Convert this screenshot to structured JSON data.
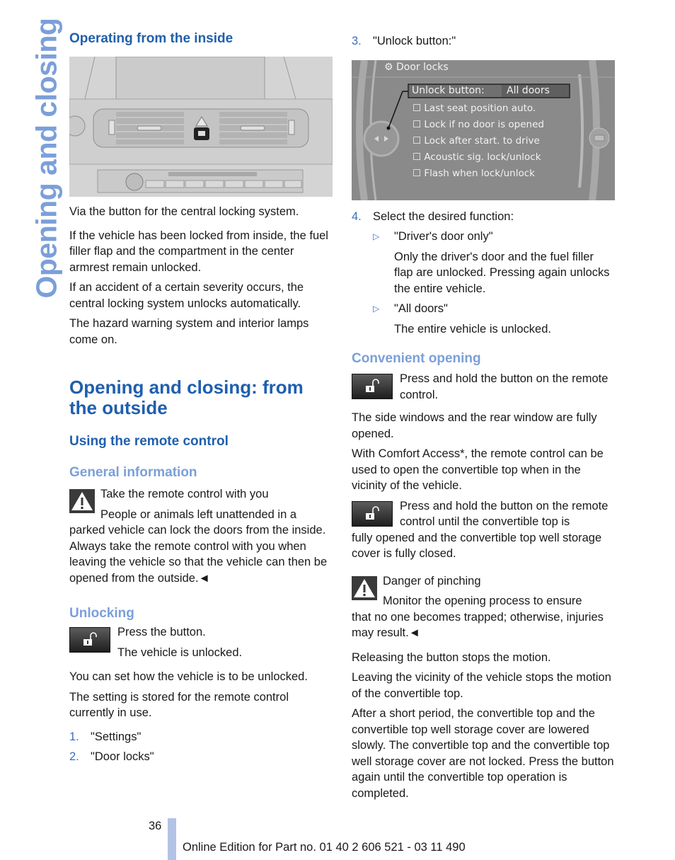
{
  "side_title": "Opening and closing",
  "left": {
    "heading_inside": "Operating from the inside",
    "p_via": "Via the button for the central locking system.",
    "p_locked_inside": "If the vehicle has been locked from inside, the fuel filler flap and the compartment in the center armrest remain unlocked.",
    "p_accident": "If an accident of a certain severity occurs, the central locking system unlocks automatically.",
    "p_hazard": "The hazard warning system and interior lamps come on.",
    "section_title": "Opening and closing: from the outside",
    "heading_remote": "Using the remote control",
    "heading_general": "General information",
    "warning_title": "Take the remote control with you",
    "warning_text_first": "People or animals left unattended in a",
    "warning_text_rest": "parked vehicle can lock the doors from the inside. Always take the remote control with you when leaving the vehicle so that the vehicle can then be opened from the outside.◄",
    "heading_unlocking": "Unlocking",
    "press_button": "Press the button.",
    "vehicle_unlocked": "The vehicle is unlocked.",
    "p_set_unlock": "You can set how the vehicle is to be unlocked.",
    "p_setting_stored": "The setting is stored for the remote control currently in use.",
    "steps": [
      {
        "num": "1.",
        "text": "\"Settings\""
      },
      {
        "num": "2.",
        "text": "\"Door locks\""
      }
    ]
  },
  "right": {
    "step3": {
      "num": "3.",
      "text": "\"Unlock button:\""
    },
    "screen": {
      "title": "Door locks",
      "unlock_label": "Unlock button:",
      "unlock_value": "All doors",
      "options": [
        "Last seat position auto.",
        "Lock if no door is opened",
        "Lock after start. to drive",
        "Acoustic sig. lock/unlock",
        "Flash when lock/unlock"
      ]
    },
    "step4": {
      "num": "4.",
      "text": "Select the desired function:"
    },
    "opt_driver": "\"Driver's door only\"",
    "opt_driver_desc": "Only the driver's door and the fuel filler flap are unlocked. Pressing again unlocks the entire vehicle.",
    "opt_all": "\"All doors\"",
    "opt_all_desc": "The entire vehicle is unlocked.",
    "heading_convenient": "Convenient opening",
    "hold_button": "Press and hold the button on the remote control.",
    "p_windows": "The side windows and the rear window are fully opened.",
    "p_comfort": "With Comfort Access*, the remote control can be used to open the convertible top when in the vicinity of the vehicle.",
    "hold_until_first": "Press and hold the button on the remote control until the convertible top is",
    "hold_until_rest": "fully opened and the convertible top well storage cover is fully closed.",
    "danger_title": "Danger of pinching",
    "danger_first": "Monitor the opening process to ensure",
    "danger_rest": "that no one becomes trapped; otherwise, injuries may result.◄",
    "p_releasing": "Releasing the button stops the motion.",
    "p_leaving": "Leaving the vicinity of the vehicle stops the motion of the convertible top.",
    "p_short_period": "After a short period, the convertible top and the convertible top well storage cover are lowered slowly. The convertible top and the convertible top well storage cover are not locked. Press the button again until the convertible top operation is completed."
  },
  "footer": {
    "page_number": "36",
    "edition": "Online Edition for Part no. 01 40 2 606 521 - 03 11 490"
  }
}
